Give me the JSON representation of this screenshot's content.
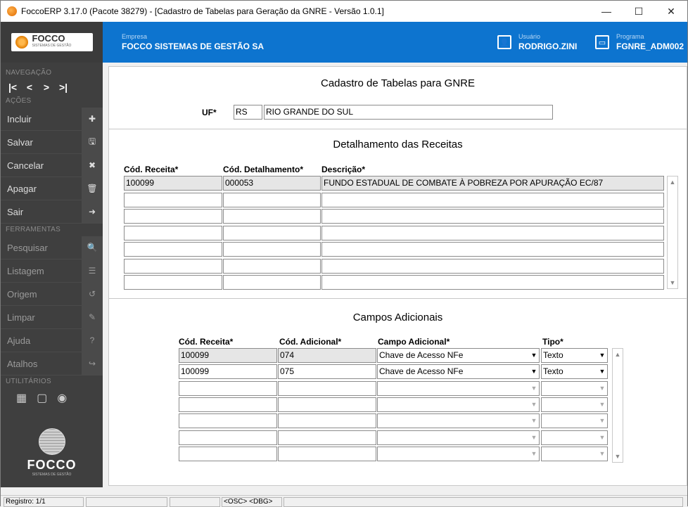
{
  "window": {
    "title": "FoccoERP 3.17.0 (Pacote 38279) - [Cadastro de Tabelas para Geração da GNRE - Versão 1.0.1]",
    "minimize": "—",
    "maximize": "☐",
    "close": "✕"
  },
  "header": {
    "logo_text": "FOCCO",
    "logo_sub": "SISTEMAS DE GESTÃO",
    "empresa_label": "Empresa",
    "empresa_value": "FOCCO SISTEMAS DE GESTÃO SA",
    "usuario_label": "Usuário",
    "usuario_value": "RODRIGO.ZINI",
    "programa_label": "Programa",
    "programa_value": "FGNRE_ADM002",
    "accent_color": "#0d74cf"
  },
  "sidebar": {
    "nav_label": "NAVEGAÇÃO",
    "nav_buttons": [
      "|<",
      "<",
      ">",
      ">|"
    ],
    "acoes_label": "AÇÕES",
    "acoes": [
      {
        "label": "Incluir",
        "icon": "plus-icon",
        "glyph": "✚"
      },
      {
        "label": "Salvar",
        "icon": "save-icon",
        "glyph": "🖫"
      },
      {
        "label": "Cancelar",
        "icon": "x-icon",
        "glyph": "✖"
      },
      {
        "label": "Apagar",
        "icon": "trash-icon",
        "glyph": "🗑"
      },
      {
        "label": "Sair",
        "icon": "exit-icon",
        "glyph": "➜"
      }
    ],
    "ferramentas_label": "FERRAMENTAS",
    "ferramentas": [
      {
        "label": "Pesquisar",
        "icon": "search-icon",
        "glyph": "🔍"
      },
      {
        "label": "Listagem",
        "icon": "list-icon",
        "glyph": "☰"
      },
      {
        "label": "Origem",
        "icon": "undo-icon",
        "glyph": "↺"
      },
      {
        "label": "Limpar",
        "icon": "eraser-icon",
        "glyph": "✎"
      },
      {
        "label": "Ajuda",
        "icon": "help-icon",
        "glyph": "?"
      },
      {
        "label": "Atalhos",
        "icon": "shortcut-icon",
        "glyph": "↪"
      }
    ],
    "utilitarios_label": "UTILITÁRIOS",
    "utilitarios": [
      "calculator-icon",
      "calendar-icon",
      "camera-icon"
    ],
    "bottom_logo": "FOCCO",
    "bottom_logo_sub": "SISTEMAS DE GESTÃO"
  },
  "main": {
    "title": "Cadastro de Tabelas para GNRE",
    "uf_label": "UF*",
    "uf_code": "RS",
    "uf_name": "RIO GRANDE DO SUL",
    "receitas": {
      "title": "Detalhamento das Receitas",
      "headers": [
        "Cód. Receita*",
        "Cód. Detalhamento*",
        "Descrição*"
      ],
      "rows": [
        [
          "100099",
          "000053",
          "FUNDO ESTADUAL DE COMBATE À POBREZA POR APURAÇÃO EC/87"
        ],
        [
          "",
          "",
          ""
        ],
        [
          "",
          "",
          ""
        ],
        [
          "",
          "",
          ""
        ],
        [
          "",
          "",
          ""
        ],
        [
          "",
          "",
          ""
        ],
        [
          "",
          "",
          ""
        ]
      ]
    },
    "campos": {
      "title": "Campos Adicionais",
      "headers": [
        "Cód. Receita*",
        "Cód. Adicional*",
        "Campo Adicional*",
        "Tipo*"
      ],
      "rows": [
        [
          "100099",
          "074",
          "Chave de Acesso NFe",
          "Texto"
        ],
        [
          "100099",
          "075",
          "Chave de Acesso NFe",
          "Texto"
        ],
        [
          "",
          "",
          "",
          ""
        ],
        [
          "",
          "",
          "",
          ""
        ],
        [
          "",
          "",
          "",
          ""
        ],
        [
          "",
          "",
          "",
          ""
        ],
        [
          "",
          "",
          "",
          ""
        ]
      ]
    }
  },
  "statusbar": {
    "registro": "Registro: 1/1",
    "osc_dbg": "<OSC> <DBG>"
  }
}
